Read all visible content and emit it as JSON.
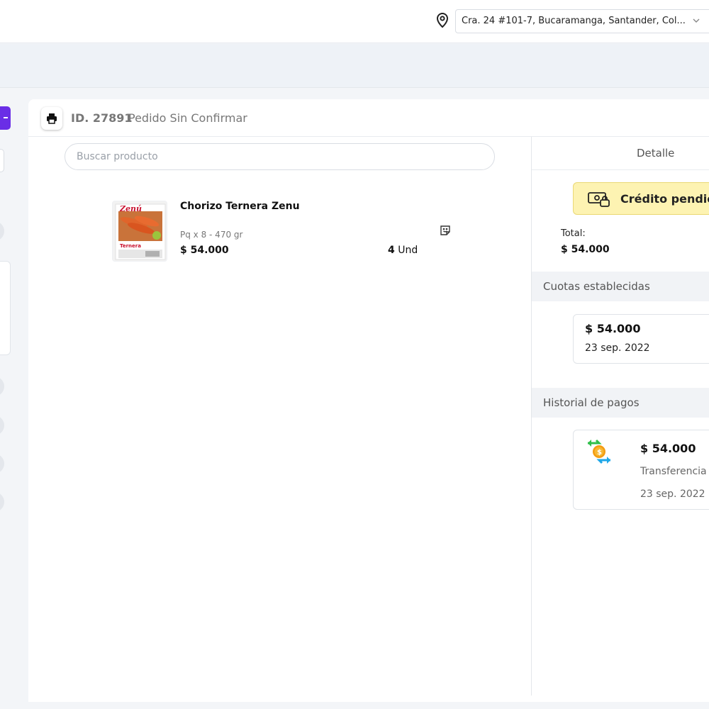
{
  "header": {
    "address": "Cra. 24 #101-7, Bucaramanga, Santander, Col..."
  },
  "order": {
    "id_label": "ID. 27891",
    "status": "Pedido Sin Confirmar"
  },
  "search": {
    "placeholder": "Buscar producto"
  },
  "product": {
    "name": "Chorizo Ternera Zenu",
    "package": "Pq x 8 - 470 gr",
    "price": "$ 54.000",
    "quantity": "4",
    "unit": "Und",
    "image_brand": "Zenú",
    "image_label": "Ternera"
  },
  "detail": {
    "tab_label": "Detalle",
    "credit_status": "Crédito pendie",
    "total_label": "Total:",
    "total_value": "$ 54.000"
  },
  "installments": {
    "title": "Cuotas establecidas",
    "items": [
      {
        "amount": "$ 54.000",
        "date": "23 sep. 2022"
      }
    ]
  },
  "payments": {
    "title": "Historial de pagos",
    "items": [
      {
        "amount": "$ 54.000",
        "method": "Transferencia",
        "date": "23 sep. 2022"
      }
    ]
  },
  "colors": {
    "accent": "#6a2ee6",
    "credit_bg": "#fdf3b2",
    "credit_border": "#ead874"
  },
  "icons": [
    "location-pin-icon",
    "chevron-down-icon",
    "printer-icon",
    "note-icon",
    "money-icon",
    "transfer-icon"
  ]
}
